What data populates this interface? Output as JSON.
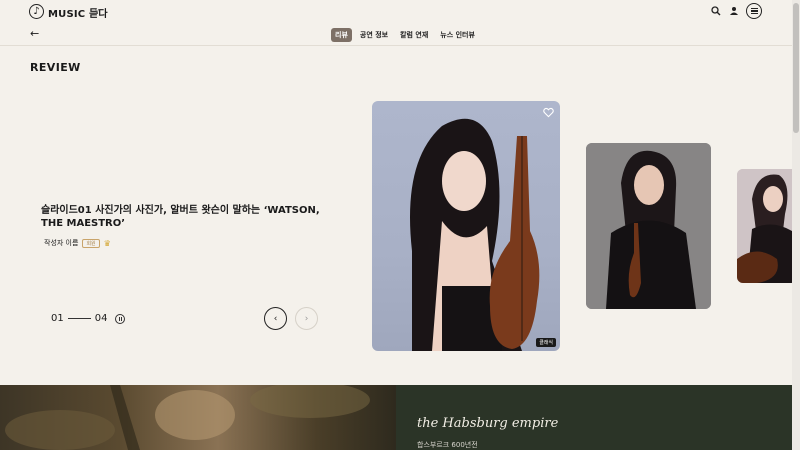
{
  "header": {
    "logo_glyph": "♪",
    "logo_text": "MUSIC 듣다",
    "logo_chevron": "v"
  },
  "nav": {
    "back": "←",
    "tabs": [
      "리뷰",
      "공연 정보",
      "칼럼 연재",
      "뉴스 인터뷰"
    ],
    "active_tab": 0
  },
  "section": {
    "title": "REVIEW"
  },
  "slide": {
    "title": "슬라이드01 사진가의 사진가, 알버트 왓슨이 말하는 ‘WATSON, THE MAESTRO’",
    "author": "작성자 이름",
    "author_badge": "회원",
    "crown": "♛",
    "pager_current": "01",
    "pager_total": "04",
    "prev": "‹",
    "next": "›"
  },
  "cards": [
    {
      "tag": "클래식"
    }
  ],
  "bottom": {
    "heading": "the Habsburg empire",
    "subheading": "합스부르크 600년전"
  },
  "colors": {
    "background": "#f4f1eb",
    "active_tab": "#7d7066",
    "bottom_panel": "#2b3427"
  }
}
